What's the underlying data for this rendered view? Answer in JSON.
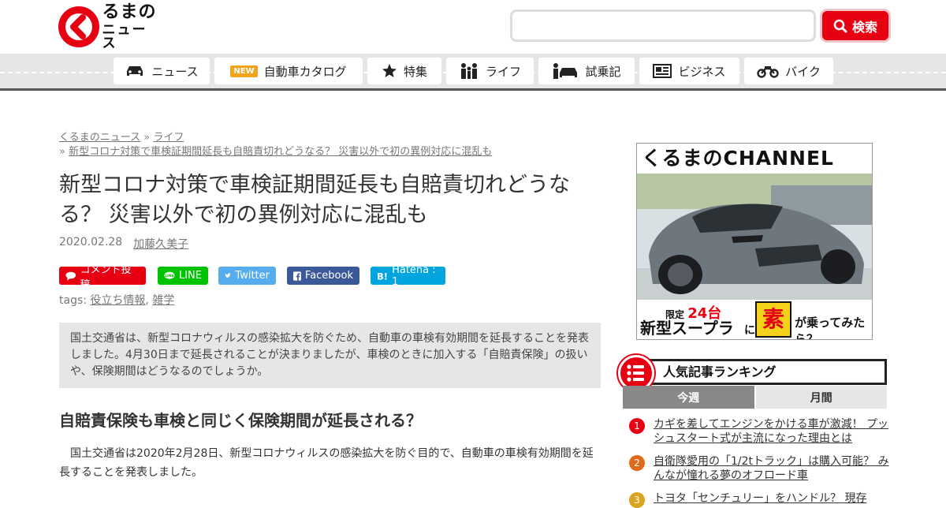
{
  "header": {
    "logo_line1": "るまの",
    "logo_line2": "ニュース",
    "search": {
      "placeholder": "",
      "button_label": "検索"
    }
  },
  "nav": {
    "items": [
      {
        "label": "ニュース",
        "icon": "car-icon"
      },
      {
        "label": "自動車カタログ",
        "badge": "NEW",
        "icon": ""
      },
      {
        "label": "特集",
        "icon": "star-icon"
      },
      {
        "label": "ライフ",
        "icon": "family-icon"
      },
      {
        "label": "試乗記",
        "icon": "test-drive-icon"
      },
      {
        "label": "ビジネス",
        "icon": "newspaper-icon"
      },
      {
        "label": "バイク",
        "icon": "motorcycle-icon"
      }
    ]
  },
  "breadcrumb": {
    "home": "くるまのニュース",
    "sep1": " » ",
    "category": "ライフ",
    "sep2": "» ",
    "current": "新型コロナ対策で車検証期間延長も自賠責切れどうなる？ 災害以外で初の異例対応に混乱も"
  },
  "article": {
    "title": "新型コロナ対策で車検証期間延長も自賠責切れどうなる？ 災害以外で初の異例対応に混乱も",
    "date": "2020.02.28",
    "author": "加藤久美子",
    "share": {
      "comment": "コメント投稿",
      "line": "LINE",
      "twitter": "Twitter",
      "facebook": "Facebook",
      "hatena": "Hatena : 1"
    },
    "tags_label": "tags:",
    "tags": [
      "役立ち情報",
      "雑学"
    ],
    "tag_sep": ", ",
    "lead": "国土交通省は、新型コロナウィルスの感染拡大を防ぐため、自動車の車検有効期間を延長することを発表しました。4月30日まで延長されることが決まりましたが、車検のときに加入する「自賠責保険」の扱いや、保険期間はどうなるのでしょうか。",
    "h2": "自賠責保険も車検と同じく保険期間が延長される？",
    "body": "国土交通省は2020年2月28日、新型コロナウィルスの感染拡大を防ぐ目的で、自動車の車検有効期間を延長することを発表しました。"
  },
  "sidebar": {
    "banner": {
      "title": "くるまのCHANNEL",
      "limited_prefix": "限定",
      "limited_count": "24台",
      "model": "新型スープラ",
      "ni": "に",
      "amateur": "素人",
      "tried": "が乗ってみたら？"
    },
    "ranking": {
      "title": "人気記事ランキング",
      "tabs": [
        "今週",
        "月間"
      ],
      "items": [
        {
          "rank": "1",
          "text": "カギを差してエンジンをかける車が激減！ プッシュスタート式が主流になった理由とは"
        },
        {
          "rank": "2",
          "text": "自衛隊愛用の「1/2tトラック」は購入可能？ みんなが憧れる夢のオフロード車"
        },
        {
          "rank": "3",
          "text": "トヨタ「センチュリー」をハンドル？ 現存"
        }
      ]
    }
  },
  "colors": {
    "brand_red": "#e60012",
    "line_green": "#00c300",
    "twitter_blue": "#55acee",
    "facebook_blue": "#3b5998",
    "hatena_blue": "#00a4de",
    "badge_orange": "#f0a31b"
  }
}
